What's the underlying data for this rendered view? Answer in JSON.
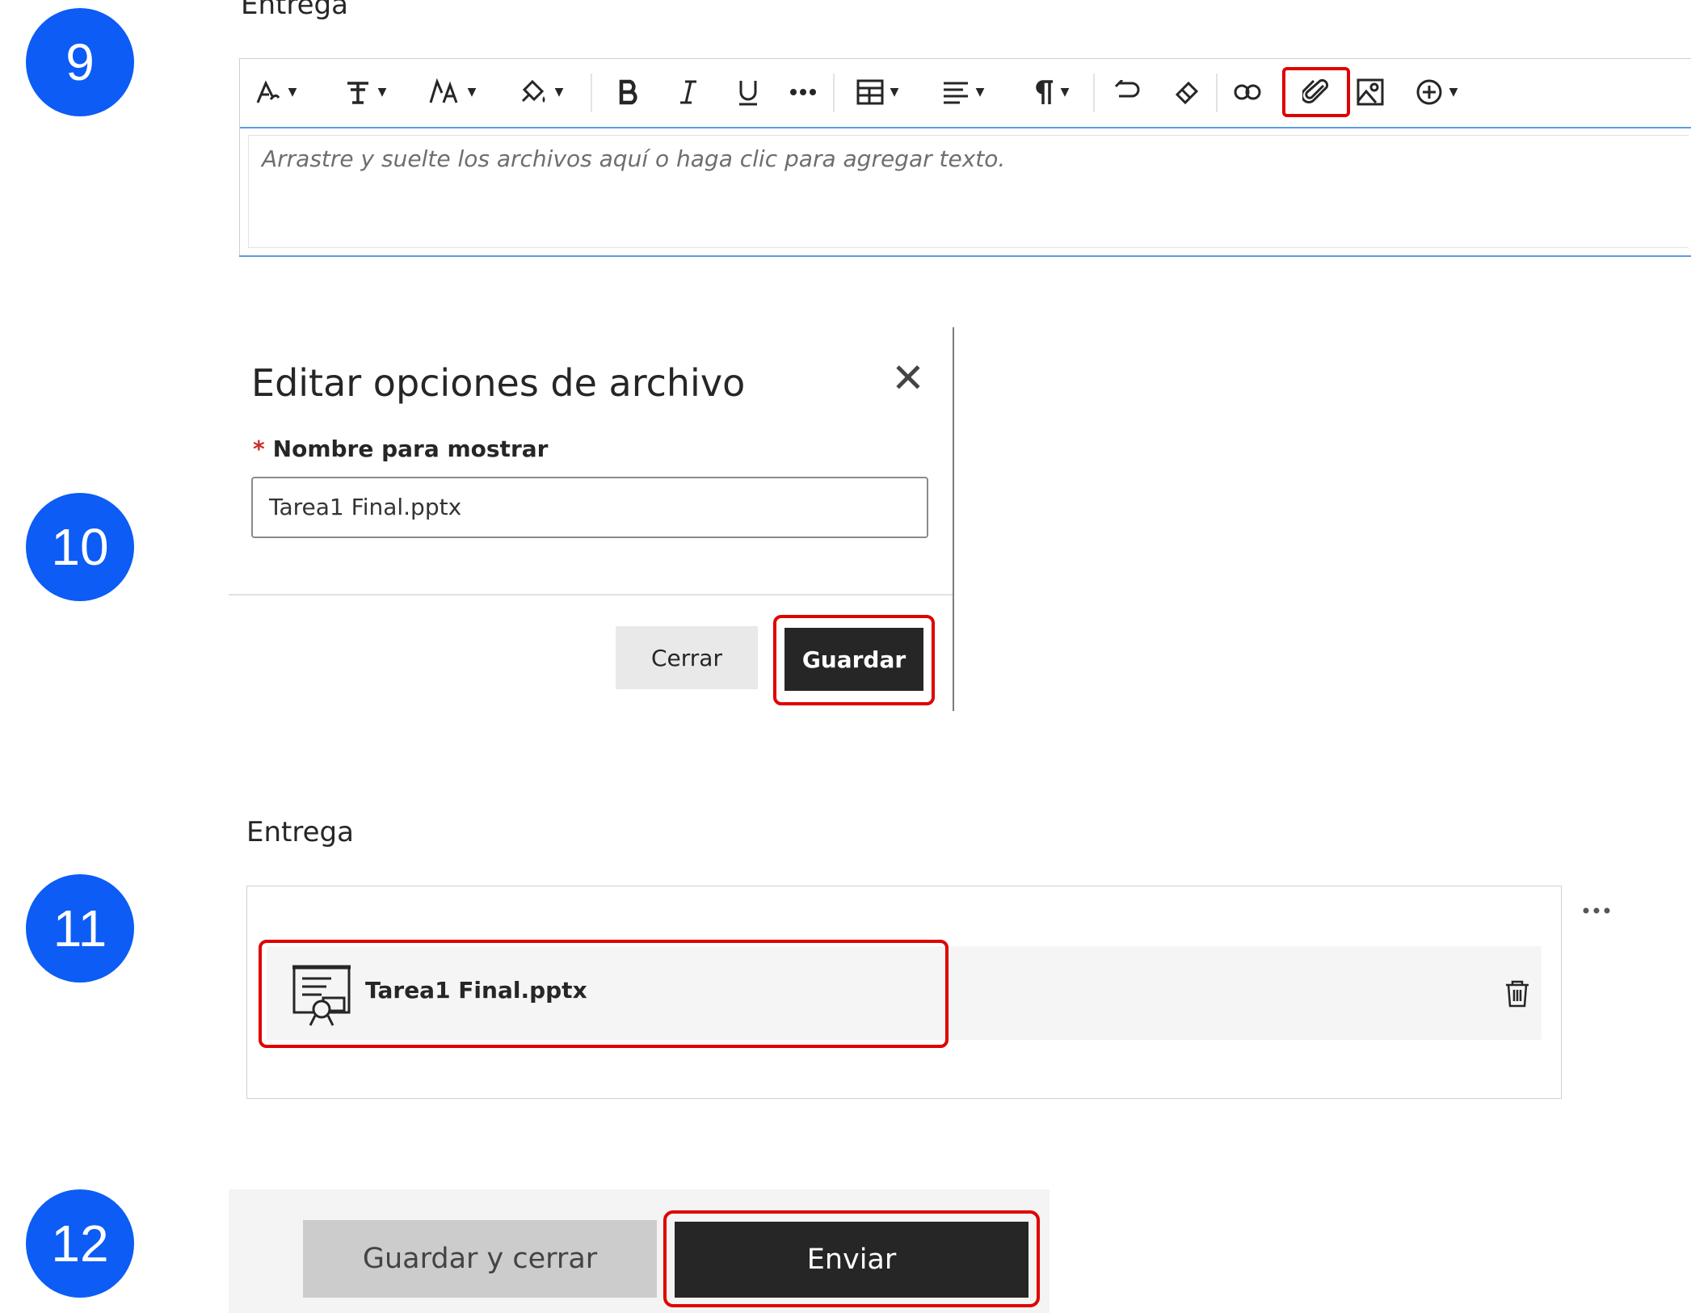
{
  "steps": [
    "9",
    "10",
    "11",
    "12"
  ],
  "editor": {
    "section_label": "Entrega",
    "placeholder": "Arrastre y suelte los archivos aquí o haga clic para agregar texto.",
    "toolbar_icons": [
      "pen-style-icon",
      "text-format-icon",
      "font-size-icon",
      "fill-color-icon",
      "bold-icon",
      "italic-icon",
      "underline-icon",
      "more-formatting-icon",
      "table-icon",
      "align-icon",
      "paragraph-icon",
      "undo-icon",
      "eraser-icon",
      "link-icon",
      "attach-file-icon",
      "insert-image-icon",
      "insert-content-icon"
    ]
  },
  "dialog": {
    "title": "Editar opciones de archivo",
    "required_mark": "*",
    "field_label": "Nombre para mostrar",
    "field_value": "Tarea1 Final.pptx",
    "close_button": "Cerrar",
    "save_button": "Guardar"
  },
  "attachment": {
    "section_label": "Entrega",
    "file_name": "Tarea1 Final.pptx",
    "file_icon": "presentation-file-icon"
  },
  "submit": {
    "save_close_button": "Guardar y cerrar",
    "send_button": "Enviar"
  },
  "colors": {
    "step_badge": "#0c5cf5",
    "highlight": "#e00000",
    "primary_button": "#262626",
    "editor_focus": "#5c9be0"
  }
}
